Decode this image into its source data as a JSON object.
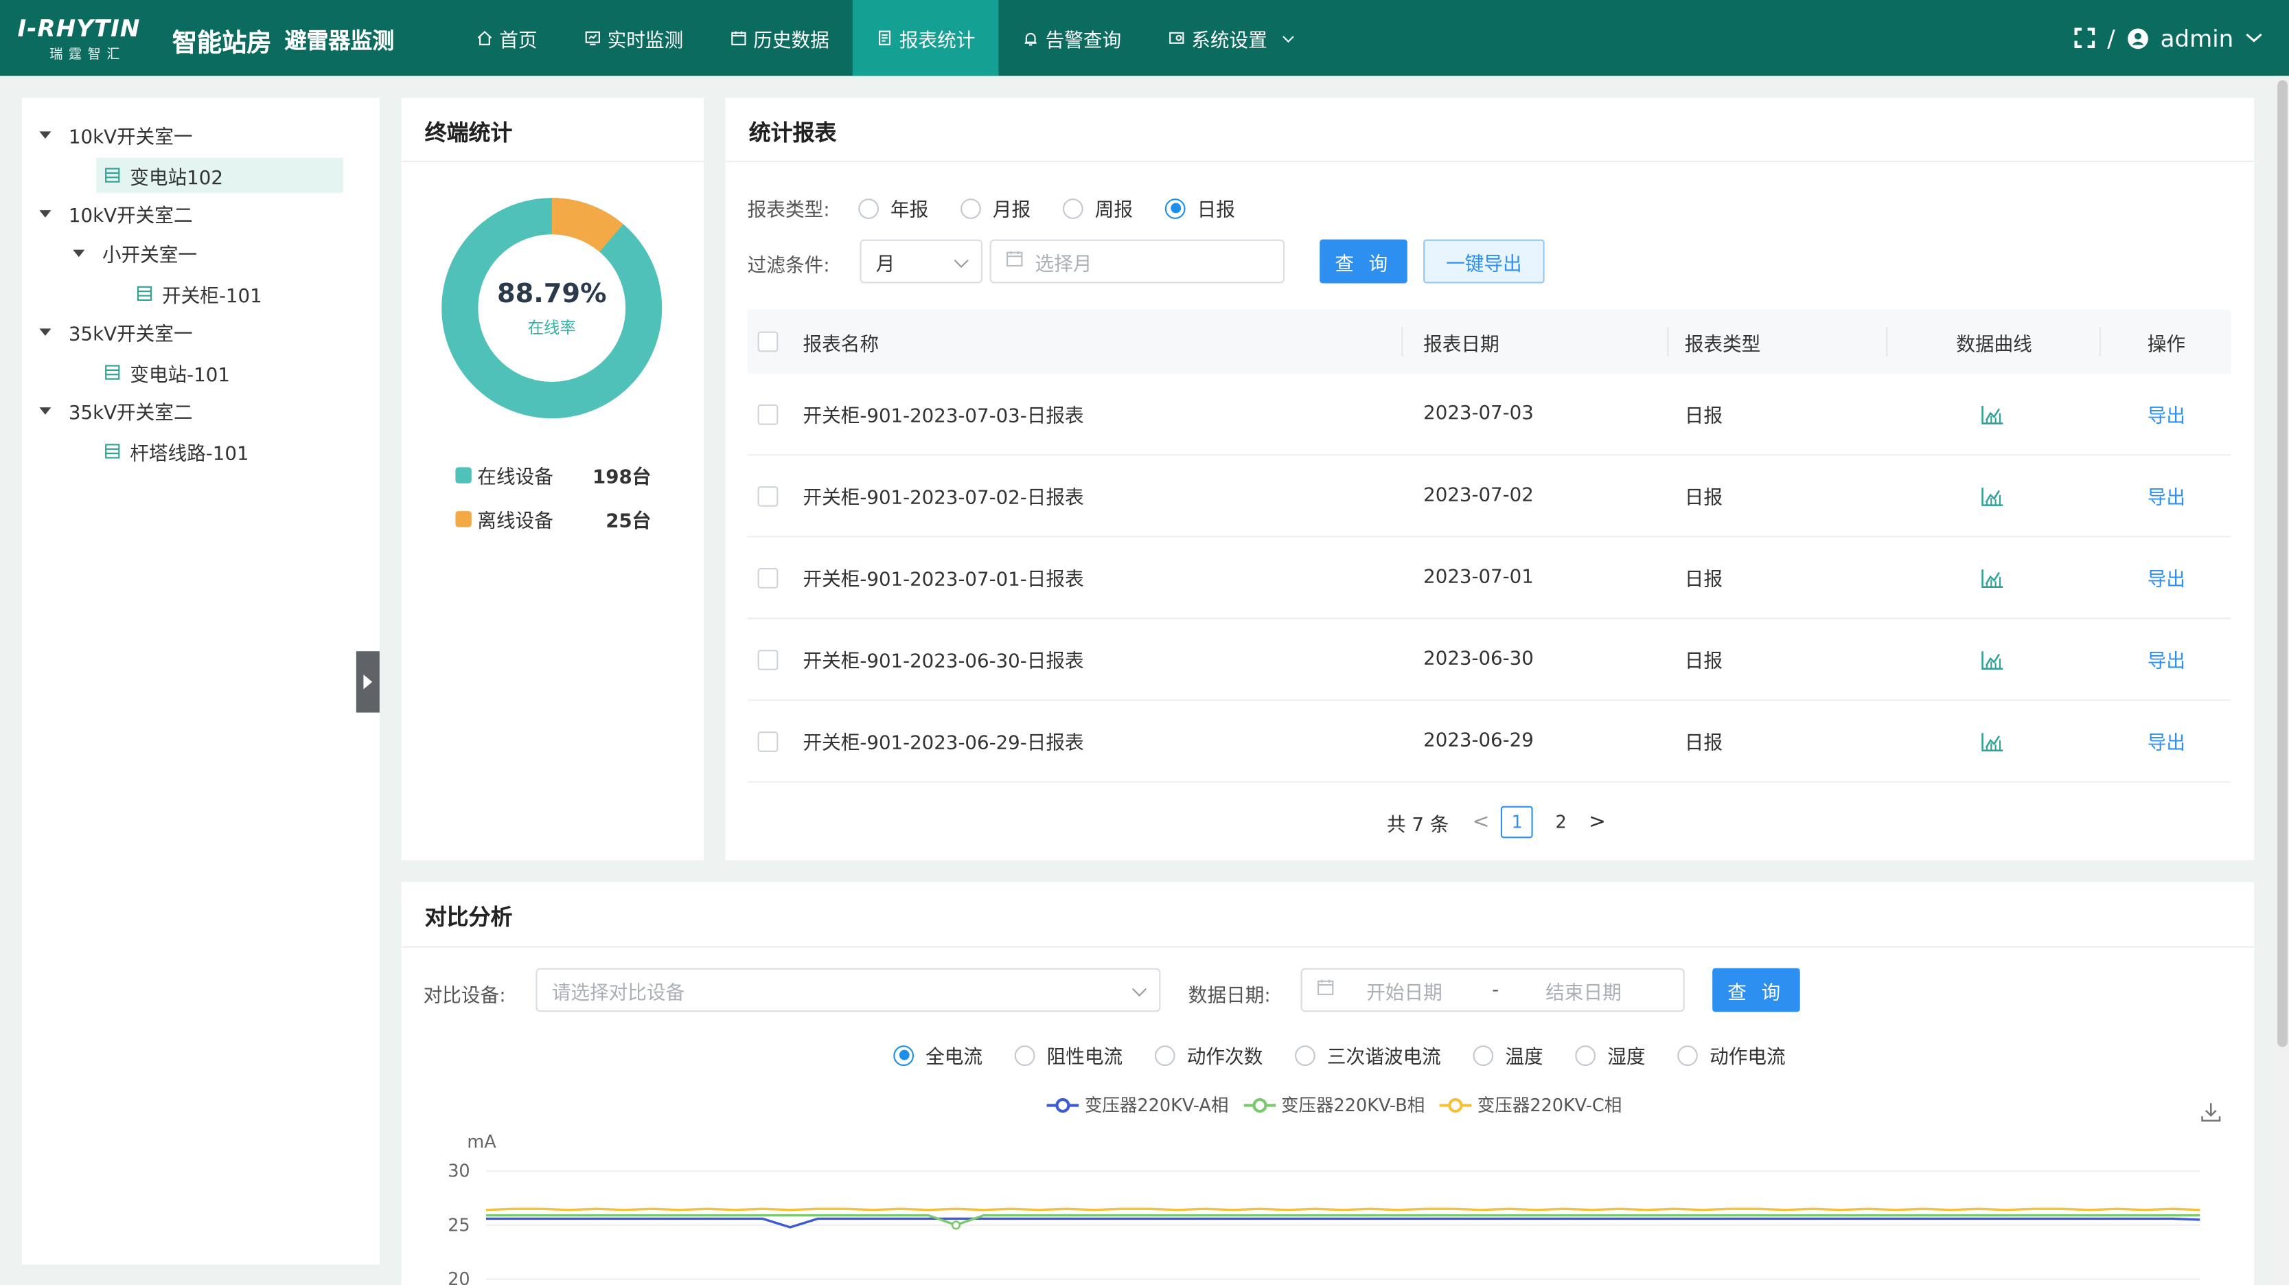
{
  "header": {
    "logo_main": "I-RHYTIN",
    "logo_sub": "瑞霆智汇",
    "app_title": "智能站房",
    "app_subtitle": "避雷器监测",
    "nav": [
      {
        "label": "首页",
        "icon": "home-icon"
      },
      {
        "label": "实时监测",
        "icon": "monitor-icon"
      },
      {
        "label": "历史数据",
        "icon": "history-icon"
      },
      {
        "label": "报表统计",
        "icon": "report-icon",
        "active": true
      },
      {
        "label": "告警查询",
        "icon": "alarm-icon"
      },
      {
        "label": "系统设置",
        "icon": "settings-icon",
        "dropdown": true
      }
    ],
    "separator": "/",
    "user": "admin"
  },
  "tree": {
    "nodes": [
      {
        "label": "10kV开关室一",
        "level": 0,
        "expandable": true
      },
      {
        "label": "变电站102",
        "level": 1,
        "selected": true
      },
      {
        "label": "10kV开关室二",
        "level": 0,
        "expandable": true
      },
      {
        "label": "小开关室一",
        "level": 1,
        "expandable": true
      },
      {
        "label": "开关柜-101",
        "level": 2
      },
      {
        "label": "35kV开关室一",
        "level": 0,
        "expandable": true
      },
      {
        "label": "变电站-101",
        "level": 1
      },
      {
        "label": "35kV开关室二",
        "level": 0,
        "expandable": true
      },
      {
        "label": "杆塔线路-101",
        "level": 1
      }
    ]
  },
  "terminal": {
    "title": "终端统计",
    "online_rate": "88.79%",
    "online_rate_label": "在线率",
    "online_fraction": 0.8879,
    "legend": [
      {
        "label": "在线设备",
        "count": "198台",
        "color": "#4fc1b9"
      },
      {
        "label": "离线设备",
        "count": "25台",
        "color": "#f4a947"
      }
    ]
  },
  "report": {
    "title": "统计报表",
    "type_label": "报表类型:",
    "types": [
      {
        "label": "年报",
        "checked": false
      },
      {
        "label": "月报",
        "checked": false
      },
      {
        "label": "周报",
        "checked": false
      },
      {
        "label": "日报",
        "checked": true
      }
    ],
    "filter_label": "过滤条件:",
    "filter_select": "月",
    "filter_date_placeholder": "选择月",
    "query_button": "查 询",
    "export_button": "一键导出",
    "columns": [
      "报表名称",
      "报表日期",
      "报表类型",
      "数据曲线",
      "操作"
    ],
    "rows": [
      {
        "name": "开关柜-901-2023-07-03-日报表",
        "date": "2023-07-03",
        "type": "日报",
        "action": "导出"
      },
      {
        "name": "开关柜-901-2023-07-02-日报表",
        "date": "2023-07-02",
        "type": "日报",
        "action": "导出"
      },
      {
        "name": "开关柜-901-2023-07-01-日报表",
        "date": "2023-07-01",
        "type": "日报",
        "action": "导出"
      },
      {
        "name": "开关柜-901-2023-06-30-日报表",
        "date": "2023-06-30",
        "type": "日报",
        "action": "导出"
      },
      {
        "name": "开关柜-901-2023-06-29-日报表",
        "date": "2023-06-29",
        "type": "日报",
        "action": "导出"
      }
    ],
    "pager": {
      "total": "共 7 条",
      "pages": [
        "1",
        "2"
      ],
      "current": "1",
      "prev": "<",
      "next": ">"
    }
  },
  "compare": {
    "title": "对比分析",
    "device_label": "对比设备:",
    "device_placeholder": "请选择对比设备",
    "date_label": "数据日期:",
    "start_placeholder": "开始日期",
    "date_sep": "-",
    "end_placeholder": "结束日期",
    "query_button": "查 询",
    "metrics": [
      {
        "label": "全电流",
        "checked": true
      },
      {
        "label": "阻性电流",
        "checked": false
      },
      {
        "label": "动作次数",
        "checked": false
      },
      {
        "label": "三次谐波电流",
        "checked": false
      },
      {
        "label": "温度",
        "checked": false
      },
      {
        "label": "湿度",
        "checked": false
      },
      {
        "label": "动作电流",
        "checked": false
      }
    ]
  },
  "chart_data": {
    "type": "line",
    "ylabel": "mA",
    "y_ticks": [
      "30",
      "25",
      "20"
    ],
    "ylim": [
      20,
      30
    ],
    "series": [
      {
        "name": "变压器220KV-A相",
        "color": "#3f5bd1",
        "values": [
          25.6,
          25.6,
          25.6,
          25.6,
          25.6,
          25.6,
          25.6,
          25.6,
          25.6,
          25.6,
          25.6,
          24.8,
          25.6,
          25.6,
          25.6,
          25.6,
          25.6,
          25.6,
          25.6,
          25.6,
          25.6,
          25.6,
          25.6,
          25.6,
          25.6,
          25.6,
          25.6,
          25.6,
          25.6,
          25.6,
          25.6,
          25.6,
          25.6,
          25.6,
          25.6,
          25.6,
          25.6,
          25.6,
          25.6,
          25.6,
          25.6,
          25.6,
          25.6,
          25.6,
          25.6,
          25.6,
          25.6,
          25.6,
          25.6,
          25.6,
          25.6,
          25.6,
          25.6,
          25.6,
          25.6,
          25.6,
          25.6,
          25.6,
          25.6,
          25.6,
          25.6,
          25.6,
          25.5
        ]
      },
      {
        "name": "变压器220KV-B相",
        "color": "#7bc96f",
        "values": [
          25.9,
          25.9,
          25.9,
          25.9,
          25.9,
          25.9,
          25.9,
          25.9,
          25.9,
          25.9,
          25.9,
          25.9,
          25.9,
          25.9,
          25.9,
          25.9,
          25.9,
          25.9,
          25.9,
          25.9,
          25.9,
          25.9,
          25.9,
          25.9,
          25.9,
          25.9,
          25.9,
          25.9,
          25.9,
          25.9,
          25.9,
          25.9,
          25.9,
          25.9,
          25.9,
          25.9,
          25.9,
          25.9,
          25.9,
          25.9,
          25.9,
          25.9,
          25.9,
          25.9,
          25.9,
          25.9,
          25.9,
          25.9,
          25.9,
          25.9,
          25.9,
          25.9,
          25.9,
          25.9,
          25.9,
          25.9,
          25.9,
          25.9,
          25.9,
          25.9,
          25.9,
          25.9,
          25.9
        ],
        "dip_index": 17,
        "dip_value": 25.0
      },
      {
        "name": "变压器220KV-C相",
        "color": "#f3c13a",
        "values": [
          26.4,
          26.5,
          26.5,
          26.4,
          26.5,
          26.4,
          26.5,
          26.4,
          26.5,
          26.4,
          26.5,
          26.4,
          26.5,
          26.5,
          26.4,
          26.5,
          26.4,
          26.5,
          26.4,
          26.5,
          26.4,
          26.5,
          26.4,
          26.5,
          26.5,
          26.4,
          26.5,
          26.4,
          26.5,
          26.4,
          26.5,
          26.4,
          26.5,
          26.4,
          26.5,
          26.5,
          26.4,
          26.5,
          26.4,
          26.5,
          26.4,
          26.5,
          26.4,
          26.5,
          26.4,
          26.5,
          26.5,
          26.4,
          26.5,
          26.4,
          26.5,
          26.4,
          26.5,
          26.4,
          26.5,
          26.4,
          26.5,
          26.5,
          26.4,
          26.5,
          26.4,
          26.5,
          26.4
        ]
      }
    ]
  }
}
